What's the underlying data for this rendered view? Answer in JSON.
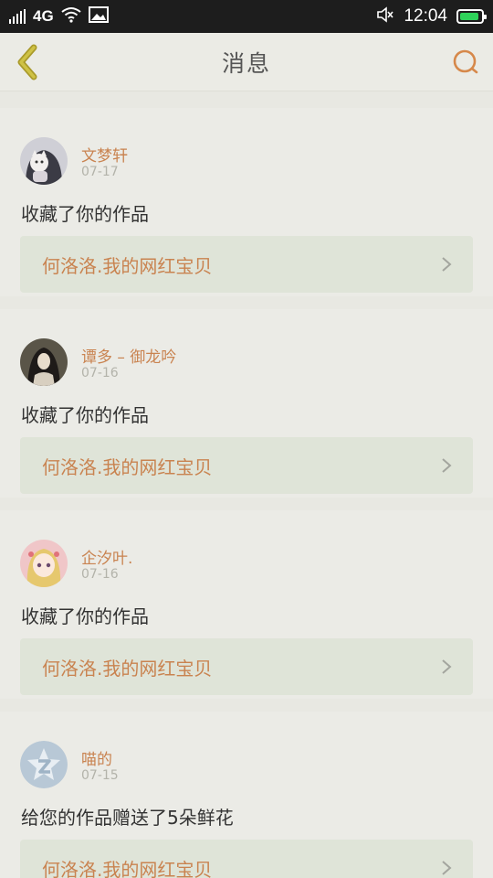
{
  "status_bar": {
    "network": "4G",
    "time": "12:04",
    "battery_level": 0.9,
    "icons": [
      "signal-icon",
      "wifi-icon",
      "image-icon",
      "mute-icon",
      "battery-icon"
    ]
  },
  "header": {
    "title": "消息",
    "back_icon": "back-chevron-icon",
    "search_icon": "search-icon",
    "accent_color": "#c98350"
  },
  "messages": [
    {
      "name": "文梦轩",
      "date": "07-17",
      "action": "收藏了你的作品",
      "work": "何洛洛.我的网红宝贝"
    },
    {
      "name": "谭多 – 御龙吟",
      "date": "07-16",
      "action": "收藏了你的作品",
      "work": "何洛洛.我的网红宝贝"
    },
    {
      "name": "企汐叶.",
      "date": "07-16",
      "action": "收藏了你的作品",
      "work": "何洛洛.我的网红宝贝"
    },
    {
      "name": "喵的",
      "date": "07-15",
      "action": "给您的作品赠送了5朵鲜花",
      "work": "何洛洛.我的网红宝贝"
    }
  ]
}
